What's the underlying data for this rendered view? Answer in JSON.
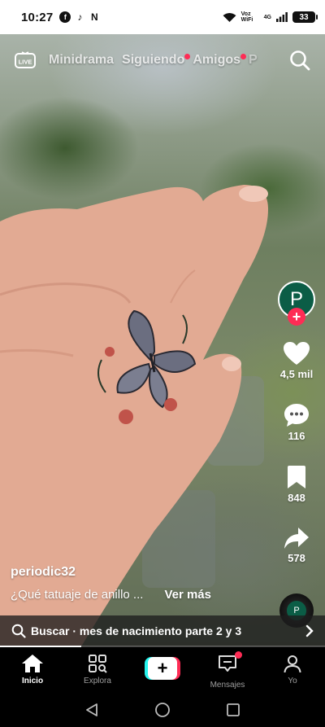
{
  "status_bar": {
    "time": "10:27",
    "network": "Voz WiFi",
    "network_gen": "4G",
    "battery": "33"
  },
  "top_tabs": {
    "live_label": "LIVE",
    "tabs": [
      "Minidrama",
      "Siguiendo",
      "Amigos",
      "P"
    ]
  },
  "rail": {
    "avatar_letter": "P",
    "likes": "4,5 mil",
    "comments": "116",
    "saves": "848",
    "shares": "578",
    "disc_letter": "P"
  },
  "caption": {
    "author": "periodic32",
    "description": "¿Qué tatuaje de anillo ...",
    "more": "Ver más"
  },
  "suggestion": {
    "text": "Buscar · mes de nacimiento parte 2 y 3",
    "progress": 0.25
  },
  "bottom_nav": {
    "home": "Inicio",
    "explore": "Explora",
    "messages": "Mensajes",
    "profile": "Yo"
  },
  "colors": {
    "accent": "#fe2c55",
    "cyan": "#25f4ee",
    "avatar": "#0b5d46"
  }
}
